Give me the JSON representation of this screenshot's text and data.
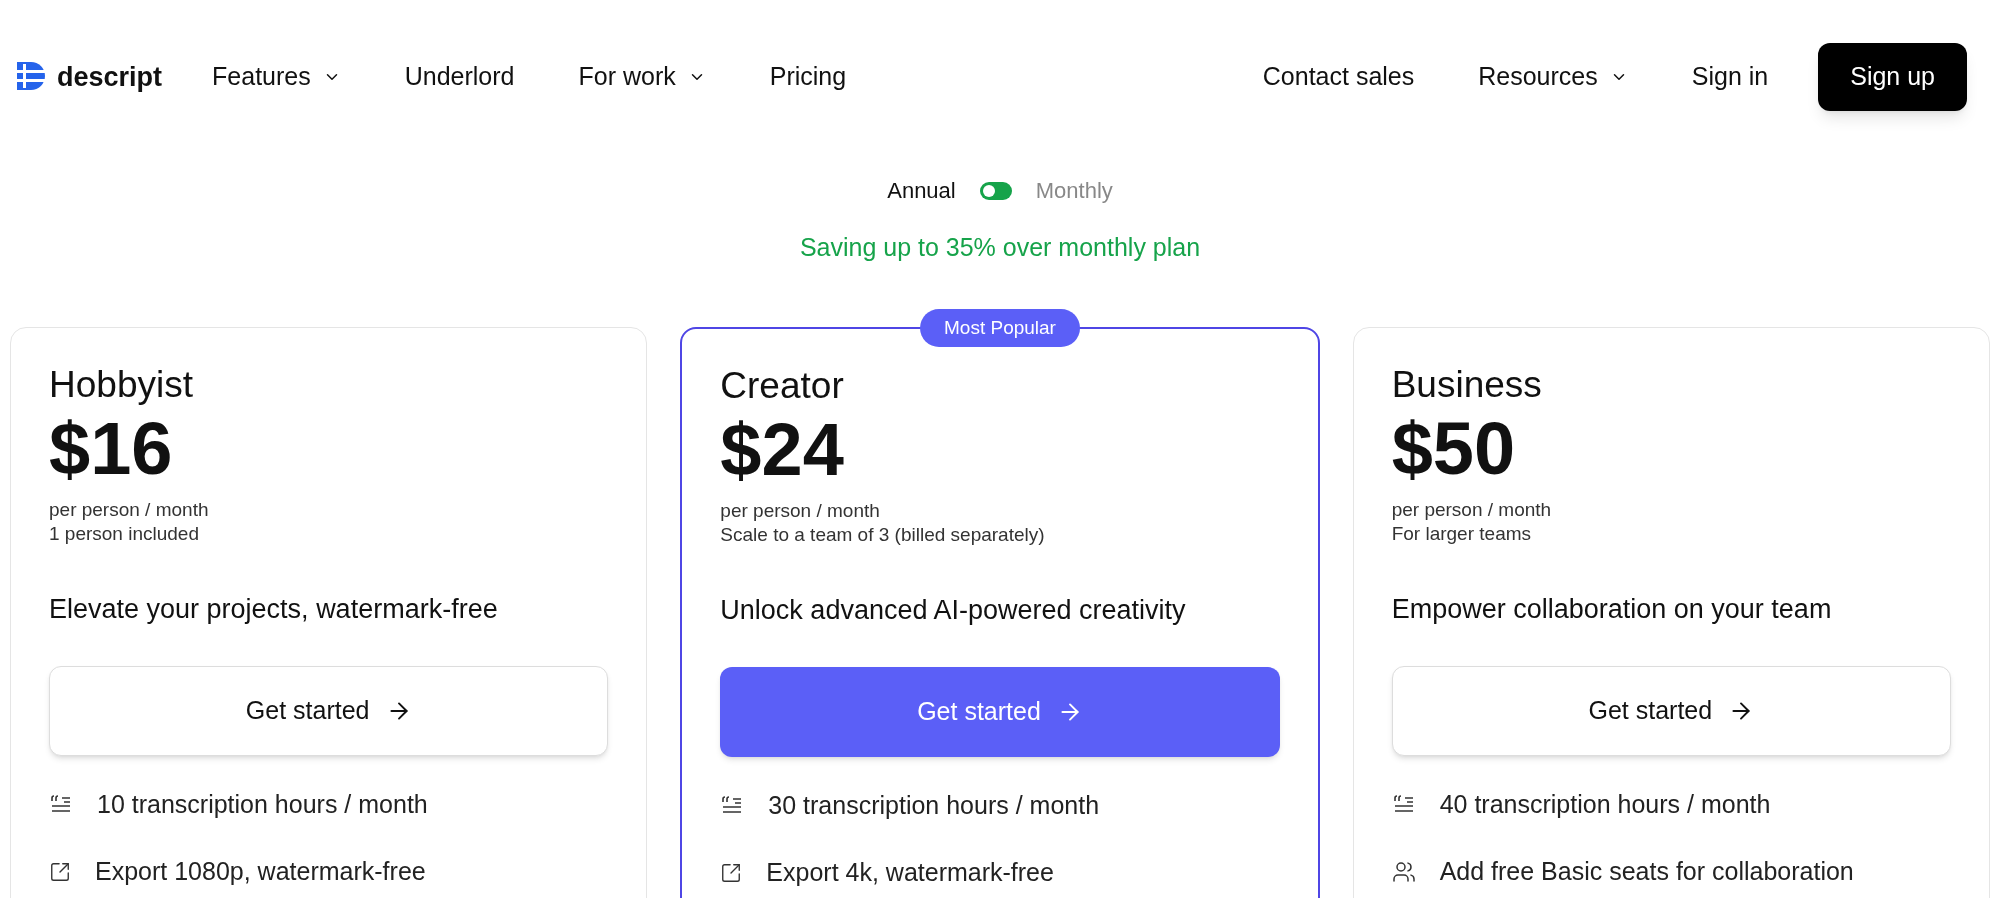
{
  "nav": {
    "logo": "descript",
    "left_links": [
      {
        "label": "Features",
        "dropdown": true
      },
      {
        "label": "Underlord",
        "dropdown": false
      },
      {
        "label": "For work",
        "dropdown": true
      },
      {
        "label": "Pricing",
        "dropdown": false
      }
    ],
    "right_links": [
      {
        "label": "Contact sales",
        "dropdown": false
      },
      {
        "label": "Resources",
        "dropdown": true
      },
      {
        "label": "Sign in",
        "dropdown": false
      }
    ],
    "signup": "Sign up"
  },
  "billing": {
    "options": [
      {
        "label": "Annual",
        "selected": true
      },
      {
        "label": "Monthly",
        "selected": false
      }
    ],
    "saving": "Saving up to 35% over monthly plan"
  },
  "plans": [
    {
      "name": "Hobbyist",
      "price": "$16",
      "per": "per person / month",
      "note": "1 person included",
      "tagline": "Elevate your projects, watermark-free",
      "featured": false,
      "cta": "Get started",
      "features": [
        {
          "kind": "transcription",
          "text": "10 transcription hours / month"
        },
        {
          "kind": "export",
          "text": "Export 1080p, watermark-free"
        }
      ]
    },
    {
      "name": "Creator",
      "price": "$24",
      "per": "per person / month",
      "note": "Scale to a team of 3 (billed separately)",
      "tagline": "Unlock advanced AI-powered creativity",
      "featured": true,
      "badge": "Most Popular",
      "cta": "Get started",
      "features": [
        {
          "kind": "transcription",
          "text": "30 transcription hours / month"
        },
        {
          "kind": "export",
          "text": "Export 4k, watermark-free"
        }
      ]
    },
    {
      "name": "Business",
      "price": "$50",
      "per": "per person / month",
      "note": "For larger teams",
      "tagline": "Empower collaboration on your team",
      "featured": false,
      "cta": "Get started",
      "features": [
        {
          "kind": "transcription",
          "text": "40 transcription hours / month"
        },
        {
          "kind": "seats",
          "text": "Add free Basic seats for collaboration"
        }
      ]
    }
  ]
}
